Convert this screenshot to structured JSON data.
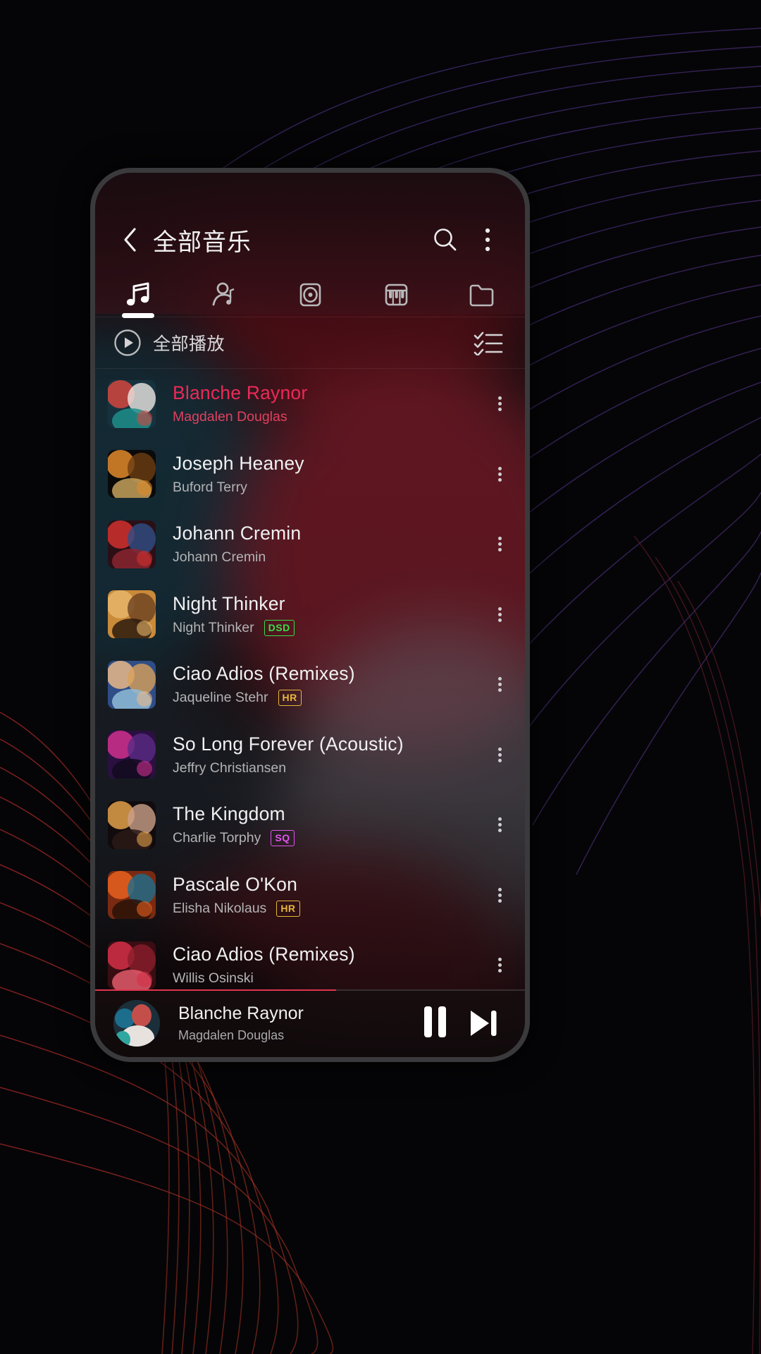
{
  "header": {
    "title": "全部音乐",
    "back_icon": "chevron-left-icon",
    "search_icon": "search-icon",
    "overflow_icon": "more-vertical-icon"
  },
  "tabs": [
    {
      "id": "songs",
      "icon": "music-note-icon",
      "active": true
    },
    {
      "id": "artists",
      "icon": "artist-icon",
      "active": false
    },
    {
      "id": "albums",
      "icon": "album-disc-icon",
      "active": false
    },
    {
      "id": "genres",
      "icon": "piano-icon",
      "active": false
    },
    {
      "id": "folders",
      "icon": "folder-icon",
      "active": false
    }
  ],
  "play_all": {
    "label": "全部播放",
    "play_icon": "play-circle-icon",
    "multiselect_icon": "checklist-icon"
  },
  "badge_colors": {
    "DSD": "#3ddc4a",
    "HR": "#e8b73a",
    "SQ": "#e254f0"
  },
  "accent": "#ec2a56",
  "songs": [
    {
      "title": "Blanche Raynor",
      "artist": "Magdalen Douglas",
      "badge": "",
      "playing": true,
      "art": "c1"
    },
    {
      "title": "Joseph Heaney",
      "artist": "Buford Terry",
      "badge": "",
      "playing": false,
      "art": "c2"
    },
    {
      "title": "Johann Cremin",
      "artist": "Johann Cremin",
      "badge": "",
      "playing": false,
      "art": "c3"
    },
    {
      "title": "Night Thinker",
      "artist": "Night Thinker",
      "badge": "DSD",
      "playing": false,
      "art": "c4"
    },
    {
      "title": "Ciao Adios (Remixes)",
      "artist": "Jaqueline Stehr",
      "badge": "HR",
      "playing": false,
      "art": "c5"
    },
    {
      "title": "So Long Forever (Acoustic)",
      "artist": "Jeffry Christiansen",
      "badge": "",
      "playing": false,
      "art": "c6"
    },
    {
      "title": "The Kingdom",
      "artist": "Charlie Torphy",
      "badge": "SQ",
      "playing": false,
      "art": "c7"
    },
    {
      "title": "Pascale O'Kon",
      "artist": "Elisha Nikolaus",
      "badge": "HR",
      "playing": false,
      "art": "c8"
    },
    {
      "title": "Ciao Adios (Remixes)",
      "artist": "Willis Osinski",
      "badge": "",
      "playing": false,
      "art": "c9"
    }
  ],
  "player": {
    "title": "Blanche Raynor",
    "artist": "Magdalen Douglas",
    "pause_icon": "pause-icon",
    "next_icon": "skip-next-icon",
    "progress_percent": 56
  }
}
